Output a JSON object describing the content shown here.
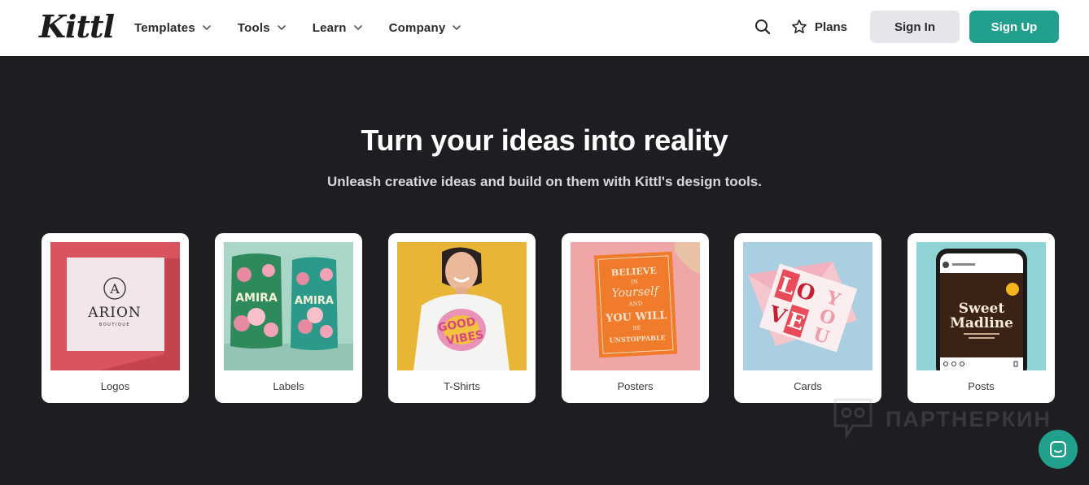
{
  "brand": {
    "logo_text": "Kittl",
    "accent": "#21a08d",
    "background": "#1e1d21"
  },
  "nav": {
    "items": [
      {
        "label": "Templates",
        "icon": "chevron-down-icon"
      },
      {
        "label": "Tools",
        "icon": "chevron-down-icon"
      },
      {
        "label": "Learn",
        "icon": "chevron-down-icon"
      },
      {
        "label": "Company",
        "icon": "chevron-down-icon"
      }
    ],
    "search_icon": "search-icon",
    "plans_icon": "star-icon",
    "plans_label": "Plans",
    "sign_in_label": "Sign In",
    "sign_up_label": "Sign Up"
  },
  "hero": {
    "title": "Turn your ideas into reality",
    "subtitle": "Unleash creative ideas and build on them with Kittl's design tools."
  },
  "categories": [
    {
      "label": "Logos",
      "thumb_text": [
        "A",
        "ARION",
        "BOUTIQUE"
      ]
    },
    {
      "label": "Labels",
      "thumb_text": [
        "AMIRA",
        "AMIRA"
      ]
    },
    {
      "label": "T-Shirts",
      "thumb_text": [
        "GOOD",
        "VIBES"
      ]
    },
    {
      "label": "Posters",
      "thumb_text": [
        "BELIEVE",
        "IN",
        "Yourself",
        "AND",
        "YOU WILL",
        "BE",
        "UNSTOPPABLE"
      ]
    },
    {
      "label": "Cards",
      "thumb_text": [
        "L",
        "O",
        "V",
        "E",
        "Y",
        "O",
        "U"
      ]
    },
    {
      "label": "Posts",
      "thumb_text": [
        "Sweet",
        "Madline"
      ]
    }
  ],
  "watermark": {
    "text": "ПАРТНЕРКИН"
  },
  "chat_icon": "chat-icon"
}
